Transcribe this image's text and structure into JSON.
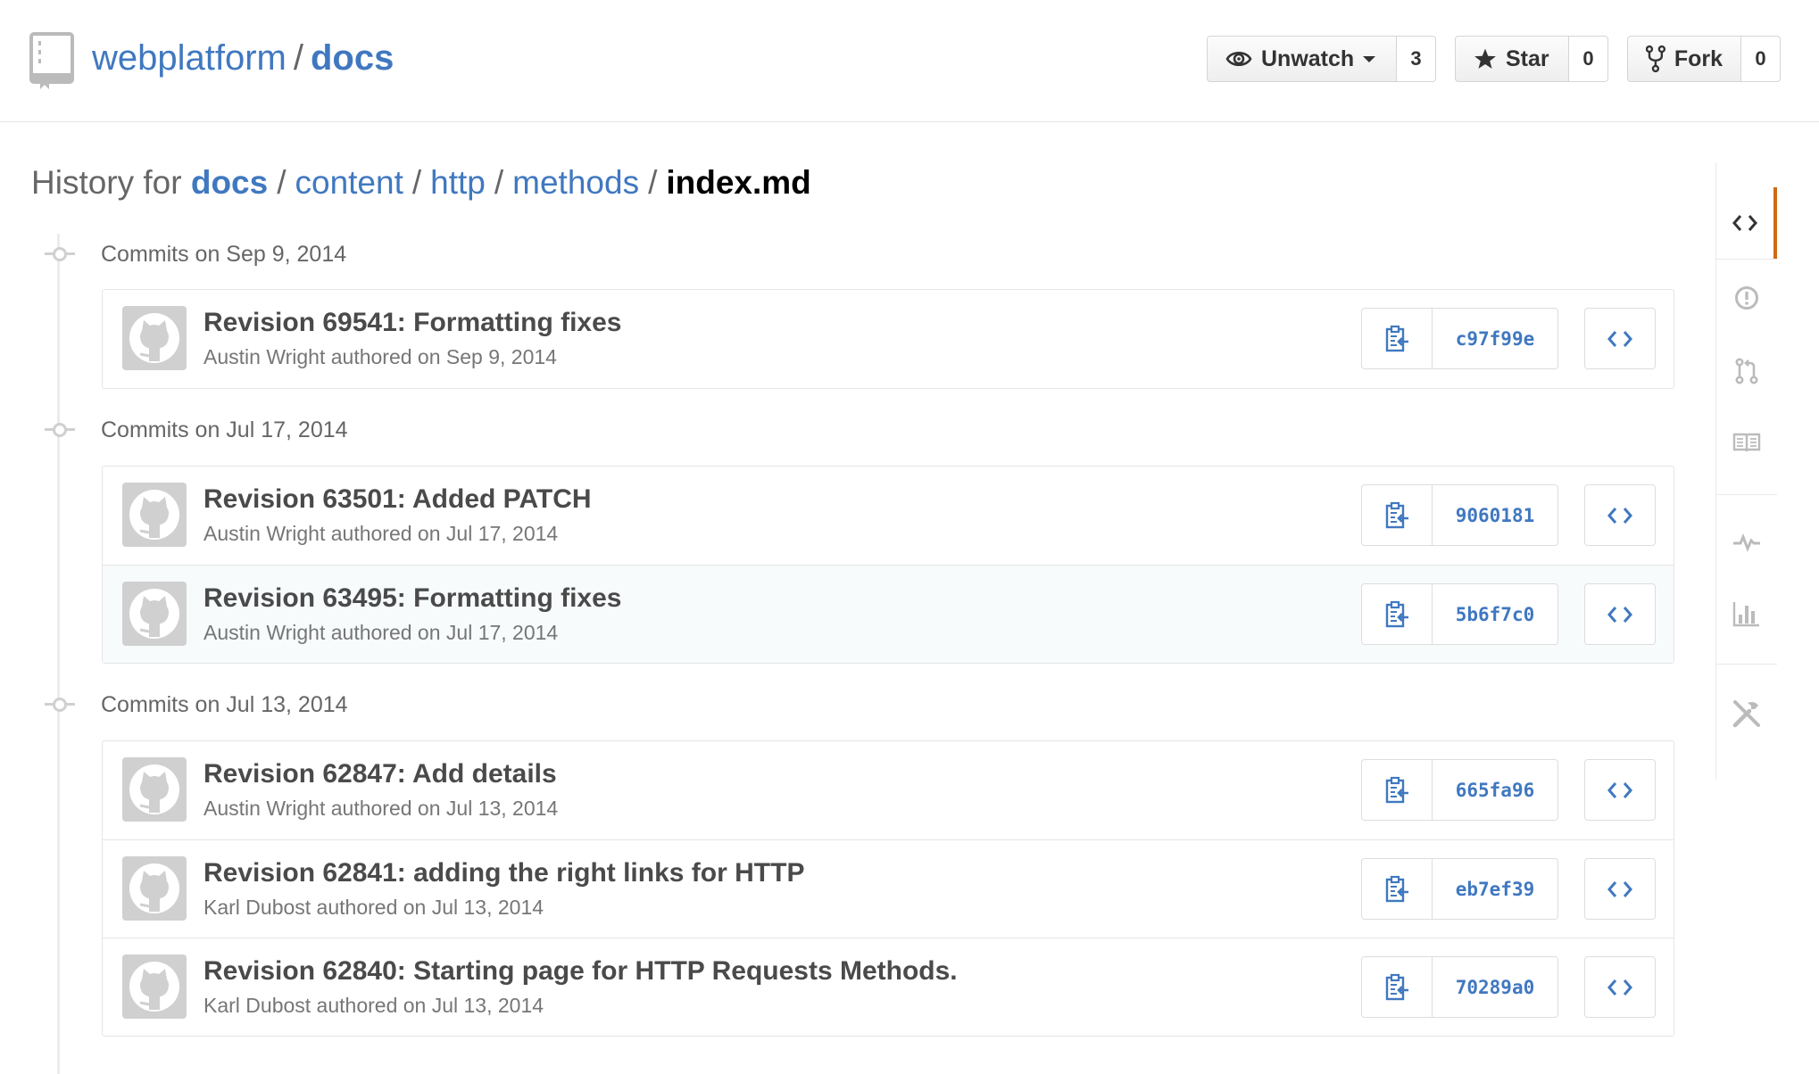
{
  "repo": {
    "owner": "webplatform",
    "separator": "/",
    "name": "docs"
  },
  "actions": {
    "watch": {
      "label": "Unwatch",
      "count": "3"
    },
    "star": {
      "label": "Star",
      "count": "0"
    },
    "fork": {
      "label": "Fork",
      "count": "0"
    }
  },
  "breadcrumb": {
    "prefix": "History for",
    "parts": [
      "docs",
      "content",
      "http",
      "methods"
    ],
    "separator": "/",
    "file": "index.md"
  },
  "days": [
    {
      "title": "Commits on Sep 9, 2014",
      "commits": [
        {
          "title": "Revision 69541: Formatting fixes",
          "meta": "Austin Wright authored on Sep 9, 2014",
          "sha": "c97f99e"
        }
      ]
    },
    {
      "title": "Commits on Jul 17, 2014",
      "commits": [
        {
          "title": "Revision 63501: Added PATCH",
          "meta": "Austin Wright authored on Jul 17, 2014",
          "sha": "9060181"
        },
        {
          "title": "Revision 63495: Formatting fixes",
          "meta": "Austin Wright authored on Jul 17, 2014",
          "sha": "5b6f7c0"
        }
      ]
    },
    {
      "title": "Commits on Jul 13, 2014",
      "commits": [
        {
          "title": "Revision 62847: Add details",
          "meta": "Austin Wright authored on Jul 13, 2014",
          "sha": "665fa96"
        },
        {
          "title": "Revision 62841: adding the right links for HTTP",
          "meta": "Karl Dubost authored on Jul 13, 2014",
          "sha": "eb7ef39"
        },
        {
          "title": "Revision 62840: Starting page for HTTP Requests Methods.",
          "meta": "Karl Dubost authored on Jul 13, 2014",
          "sha": "70289a0"
        }
      ]
    }
  ],
  "sidenav": [
    "code-icon",
    "issues-icon",
    "pull-request-icon",
    "wiki-icon",
    "pulse-icon",
    "graph-icon",
    "settings-icon"
  ],
  "colors": {
    "link": "#4078c0",
    "nav_selected": "#d26911",
    "sha": "#4078c0"
  }
}
